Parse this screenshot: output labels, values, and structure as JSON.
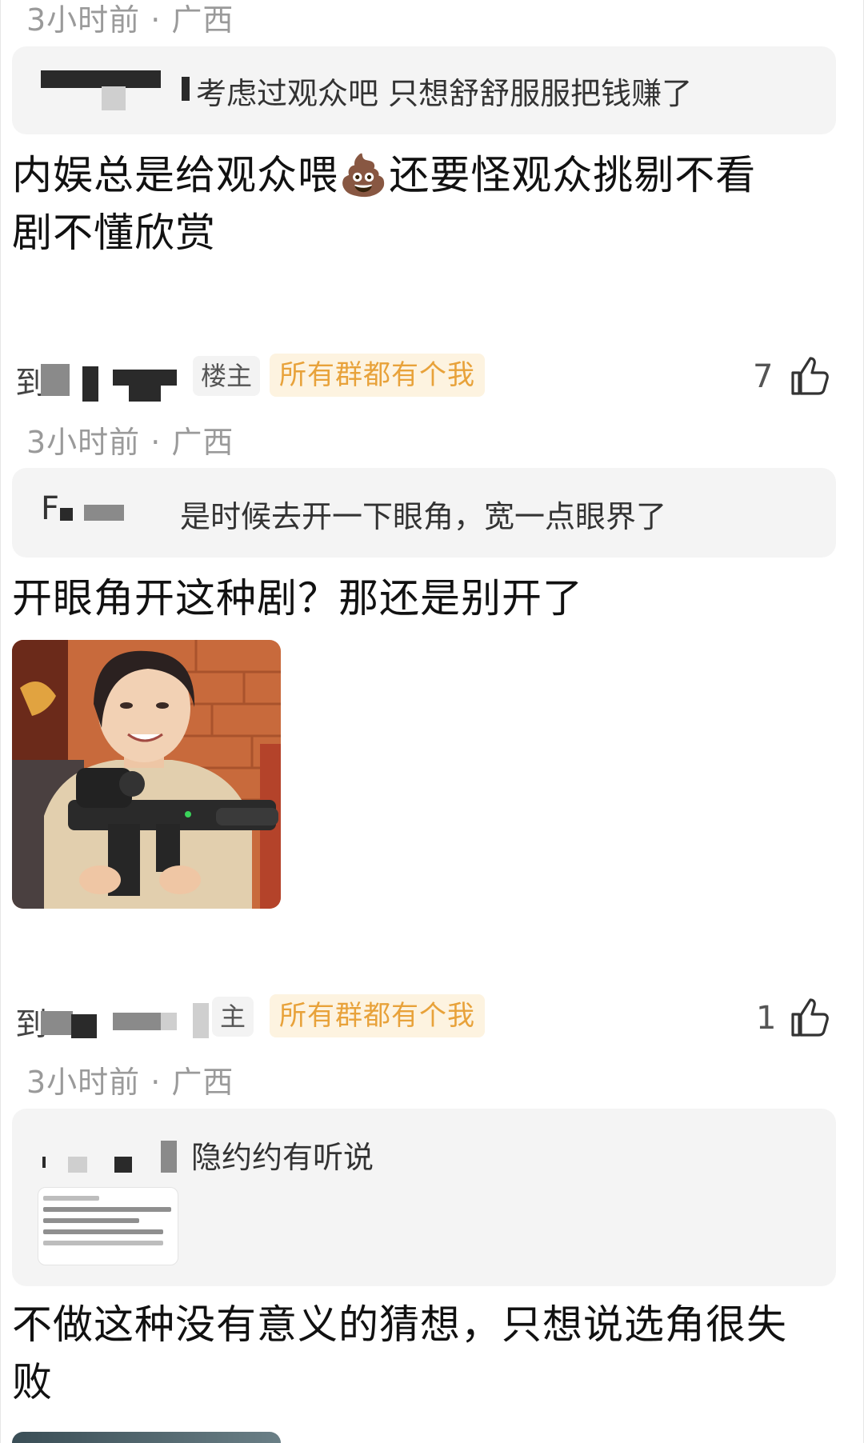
{
  "top_meta": "3小时前 · 广西",
  "thread": [
    {
      "id": "c1",
      "quote": {
        "text": "考虑过观众吧 只想舒舒服服把钱赚了"
      },
      "text_line1": "内娱总是给观众喂",
      "emoji": "💩",
      "text_line1_b": "还要怪观众挑剔不看",
      "text_line2": "剧不懂欣赏"
    },
    {
      "id": "c2",
      "author_prefix": "到",
      "op_badge": "楼主",
      "group_tag": "所有群都有个我",
      "likes": "7",
      "meta": "3小时前 · 广西",
      "quote": {
        "author_prefix": "F",
        "text": "是时候去开一下眼角，宽一点眼界了"
      },
      "text": "开眼角开这种剧？那还是别开了"
    },
    {
      "id": "c3",
      "author_prefix": "到",
      "op_badge": "主",
      "group_tag": "所有群都有个我",
      "likes": "1",
      "meta": "3小时前 · 广西",
      "quote": {
        "text": "隐约约有听说"
      },
      "text_line1": "不做这种没有意义的猜想，只想说选角很失",
      "text_line2": "败"
    }
  ],
  "icons": {
    "like": "thumbs-up-icon",
    "photo": "woman-with-rifle-photo",
    "thumb": "text-screenshot-thumbnail"
  },
  "colors": {
    "group_tag_text": "#e8a23a",
    "group_tag_bg": "#fdf3e0",
    "quote_bg": "#f4f4f4",
    "meta": "#9a9a9a"
  }
}
